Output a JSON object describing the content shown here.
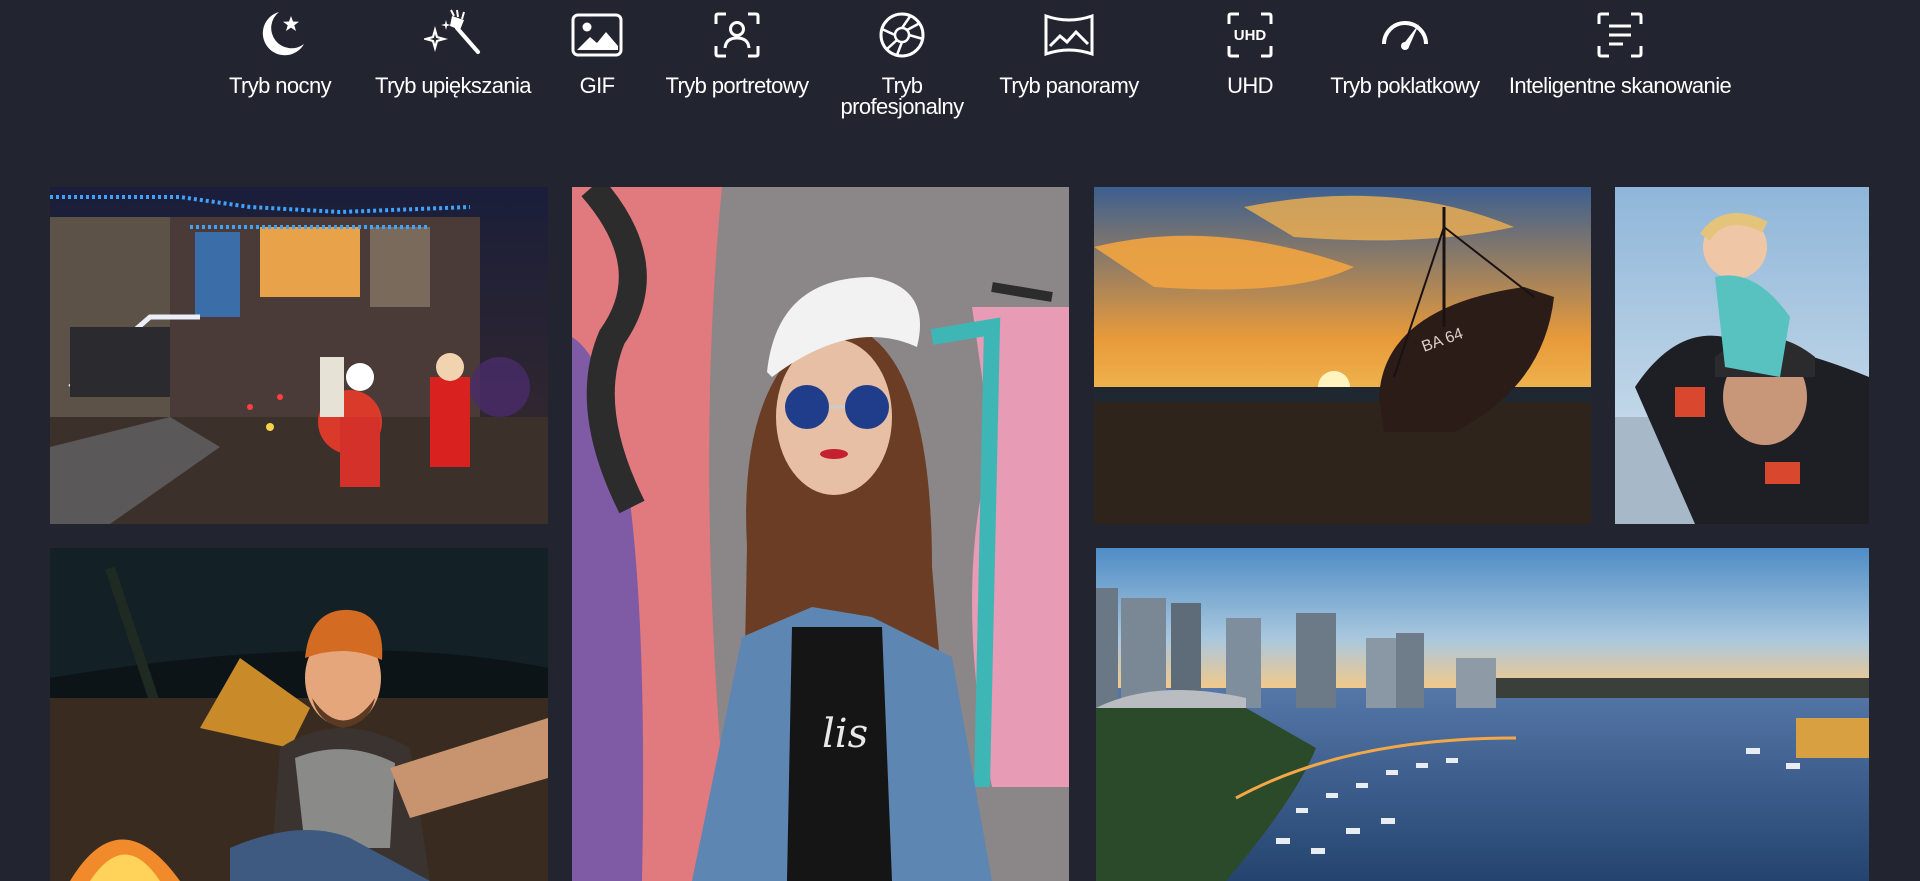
{
  "modes": [
    {
      "label": "Tryb nocny",
      "icon": "moon-star-icon"
    },
    {
      "label": "Tryb upiększania",
      "icon": "magic-brush-icon"
    },
    {
      "label": "GIF",
      "icon": "image-icon"
    },
    {
      "label": "Tryb portretowy",
      "icon": "portrait-frame-icon"
    },
    {
      "label": "Tryb\nprofesjonalny",
      "icon": "aperture-icon"
    },
    {
      "label": "Tryb panoramy",
      "icon": "panorama-icon"
    },
    {
      "label": "UHD",
      "icon": "uhd-icon"
    },
    {
      "label": "Tryb poklatkowy",
      "icon": "speedometer-icon"
    },
    {
      "label": "Inteligentne skanowanie",
      "icon": "document-scan-icon"
    }
  ],
  "photos": [
    {
      "subject": "christmas-house-photo"
    },
    {
      "subject": "graffiti-portrait-photo"
    },
    {
      "subject": "ship-sunset-photo"
    },
    {
      "subject": "father-child-photo"
    },
    {
      "subject": "campfire-selfie-photo"
    },
    {
      "subject": "harbor-city-photo"
    }
  ],
  "colors": {
    "background": "#222530",
    "text": "#ffffff"
  }
}
